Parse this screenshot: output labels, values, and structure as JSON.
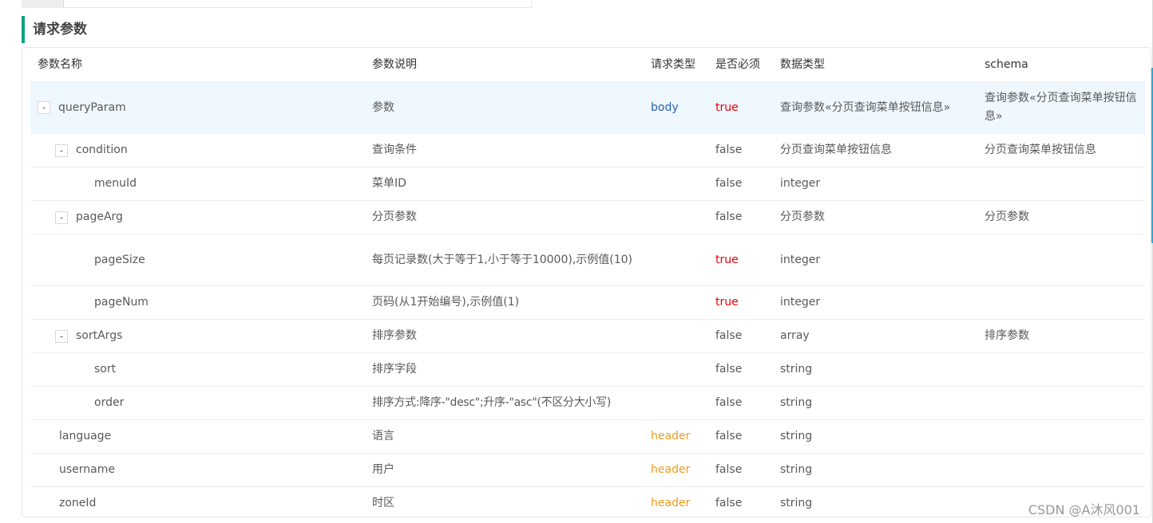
{
  "section": {
    "title": "请求参数"
  },
  "table": {
    "headers": [
      "参数名称",
      "参数说明",
      "请求类型",
      "是否必须",
      "数据类型",
      "schema"
    ],
    "rows": [
      {
        "name": "queryParam",
        "desc": "参数",
        "in": "body",
        "required": "true",
        "type": "查询参数«分页查询菜单按钮信息»",
        "schema": "查询参数«分页查询菜单按钮信息»",
        "toggle": "-"
      },
      {
        "name": "condition",
        "desc": "查询条件",
        "in": "",
        "required": "false",
        "type": "分页查询菜单按钮信息",
        "schema": "分页查询菜单按钮信息",
        "toggle": "-"
      },
      {
        "name": "menuId",
        "desc": "菜单ID",
        "in": "",
        "required": "false",
        "type": "integer",
        "schema": ""
      },
      {
        "name": "pageArg",
        "desc": "分页参数",
        "in": "",
        "required": "false",
        "type": "分页参数",
        "schema": "分页参数",
        "toggle": "-"
      },
      {
        "name": "pageSize",
        "desc": "每页记录数(大于等于1,小于等于10000),示例值(10)",
        "in": "",
        "required": "true",
        "type": "integer",
        "schema": ""
      },
      {
        "name": "pageNum",
        "desc": "页码(从1开始编号),示例值(1)",
        "in": "",
        "required": "true",
        "type": "integer",
        "schema": ""
      },
      {
        "name": "sortArgs",
        "desc": "排序参数",
        "in": "",
        "required": "false",
        "type": "array",
        "schema": "排序参数",
        "toggle": "-"
      },
      {
        "name": "sort",
        "desc": "排序字段",
        "in": "",
        "required": "false",
        "type": "string",
        "schema": ""
      },
      {
        "name": "order",
        "desc": "排序方式:降序-\"desc\";升序-\"asc\"(不区分大小写)",
        "in": "",
        "required": "false",
        "type": "string",
        "schema": ""
      },
      {
        "name": "language",
        "desc": "语言",
        "in": "header",
        "required": "false",
        "type": "string",
        "schema": ""
      },
      {
        "name": "username",
        "desc": "用户",
        "in": "header",
        "required": "false",
        "type": "string",
        "schema": ""
      },
      {
        "name": "zoneId",
        "desc": "时区",
        "in": "header",
        "required": "false",
        "type": "string",
        "schema": ""
      }
    ]
  },
  "watermark": "CSDN @A沐风001",
  "colors": {
    "accent": "#10a37f",
    "required_true": "#e60000",
    "in_body": "#1f5fbf",
    "in_header": "#f09b1a",
    "highlight_row": "#f0f8ff"
  }
}
